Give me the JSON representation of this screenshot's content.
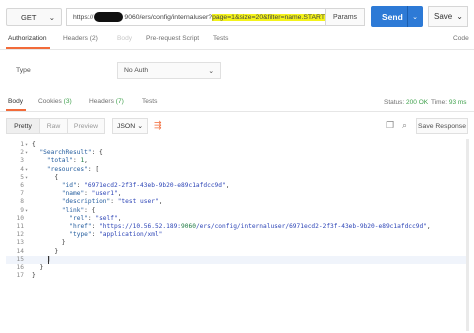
{
  "request": {
    "method": "GET",
    "url_prefix": "https://",
    "url_mid": "9060/ers/config/internaluser?",
    "url_highlight": "page=1&size=20&filter=name.START",
    "params_label": "Params",
    "send_label": "Send",
    "save_label": "Save"
  },
  "req_tabs": {
    "authorization": "Authorization",
    "headers": "Headers",
    "headers_count": "(2)",
    "body": "Body",
    "prerequest": "Pre-request Script",
    "tests": "Tests",
    "code": "Code"
  },
  "auth": {
    "type_label": "Type",
    "type_value": "No Auth"
  },
  "resp_tabs": {
    "body": "Body",
    "cookies": "Cookies",
    "cookies_count": "(3)",
    "headers": "Headers",
    "headers_count": "(7)",
    "tests": "Tests"
  },
  "status": {
    "status_label": "Status:",
    "status_value": "200 OK",
    "time_label": "Time:",
    "time_value": "93 ms"
  },
  "toolbar": {
    "pretty": "Pretty",
    "raw": "Raw",
    "preview": "Preview",
    "format": "JSON",
    "save_response": "Save Response"
  },
  "code_lines": [
    {
      "n": "1",
      "fold": "▾",
      "t": "{"
    },
    {
      "n": "2",
      "fold": "▾",
      "t": "  \"SearchResult\": {"
    },
    {
      "n": "3",
      "fold": "",
      "t": "    \"total\": 1,"
    },
    {
      "n": "4",
      "fold": "▾",
      "t": "    \"resources\": ["
    },
    {
      "n": "5",
      "fold": "▾",
      "t": "      {"
    },
    {
      "n": "6",
      "fold": "",
      "t": "        \"id\": \"6971ecd2-2f3f-43eb-9b20-e89c1afdcc9d\","
    },
    {
      "n": "7",
      "fold": "",
      "t": "        \"name\": \"user1\","
    },
    {
      "n": "8",
      "fold": "",
      "t": "        \"description\": \"test user\","
    },
    {
      "n": "9",
      "fold": "▾",
      "t": "        \"link\": {"
    },
    {
      "n": "10",
      "fold": "",
      "t": "          \"rel\": \"self\","
    },
    {
      "n": "11",
      "fold": "",
      "t": "          \"href\": \"https://10.56.52.189:9060/ers/config/internaluser/6971ecd2-2f3f-43eb-9b20-e89c1afdcc9d\","
    },
    {
      "n": "12",
      "fold": "",
      "t": "          \"type\": \"application/xml\""
    },
    {
      "n": "13",
      "fold": "",
      "t": "        }"
    },
    {
      "n": "14",
      "fold": "",
      "t": "      }"
    },
    {
      "n": "15",
      "fold": "",
      "t": "    ]"
    },
    {
      "n": "16",
      "fold": "",
      "t": "  }"
    },
    {
      "n": "17",
      "fold": "",
      "t": "}"
    }
  ]
}
